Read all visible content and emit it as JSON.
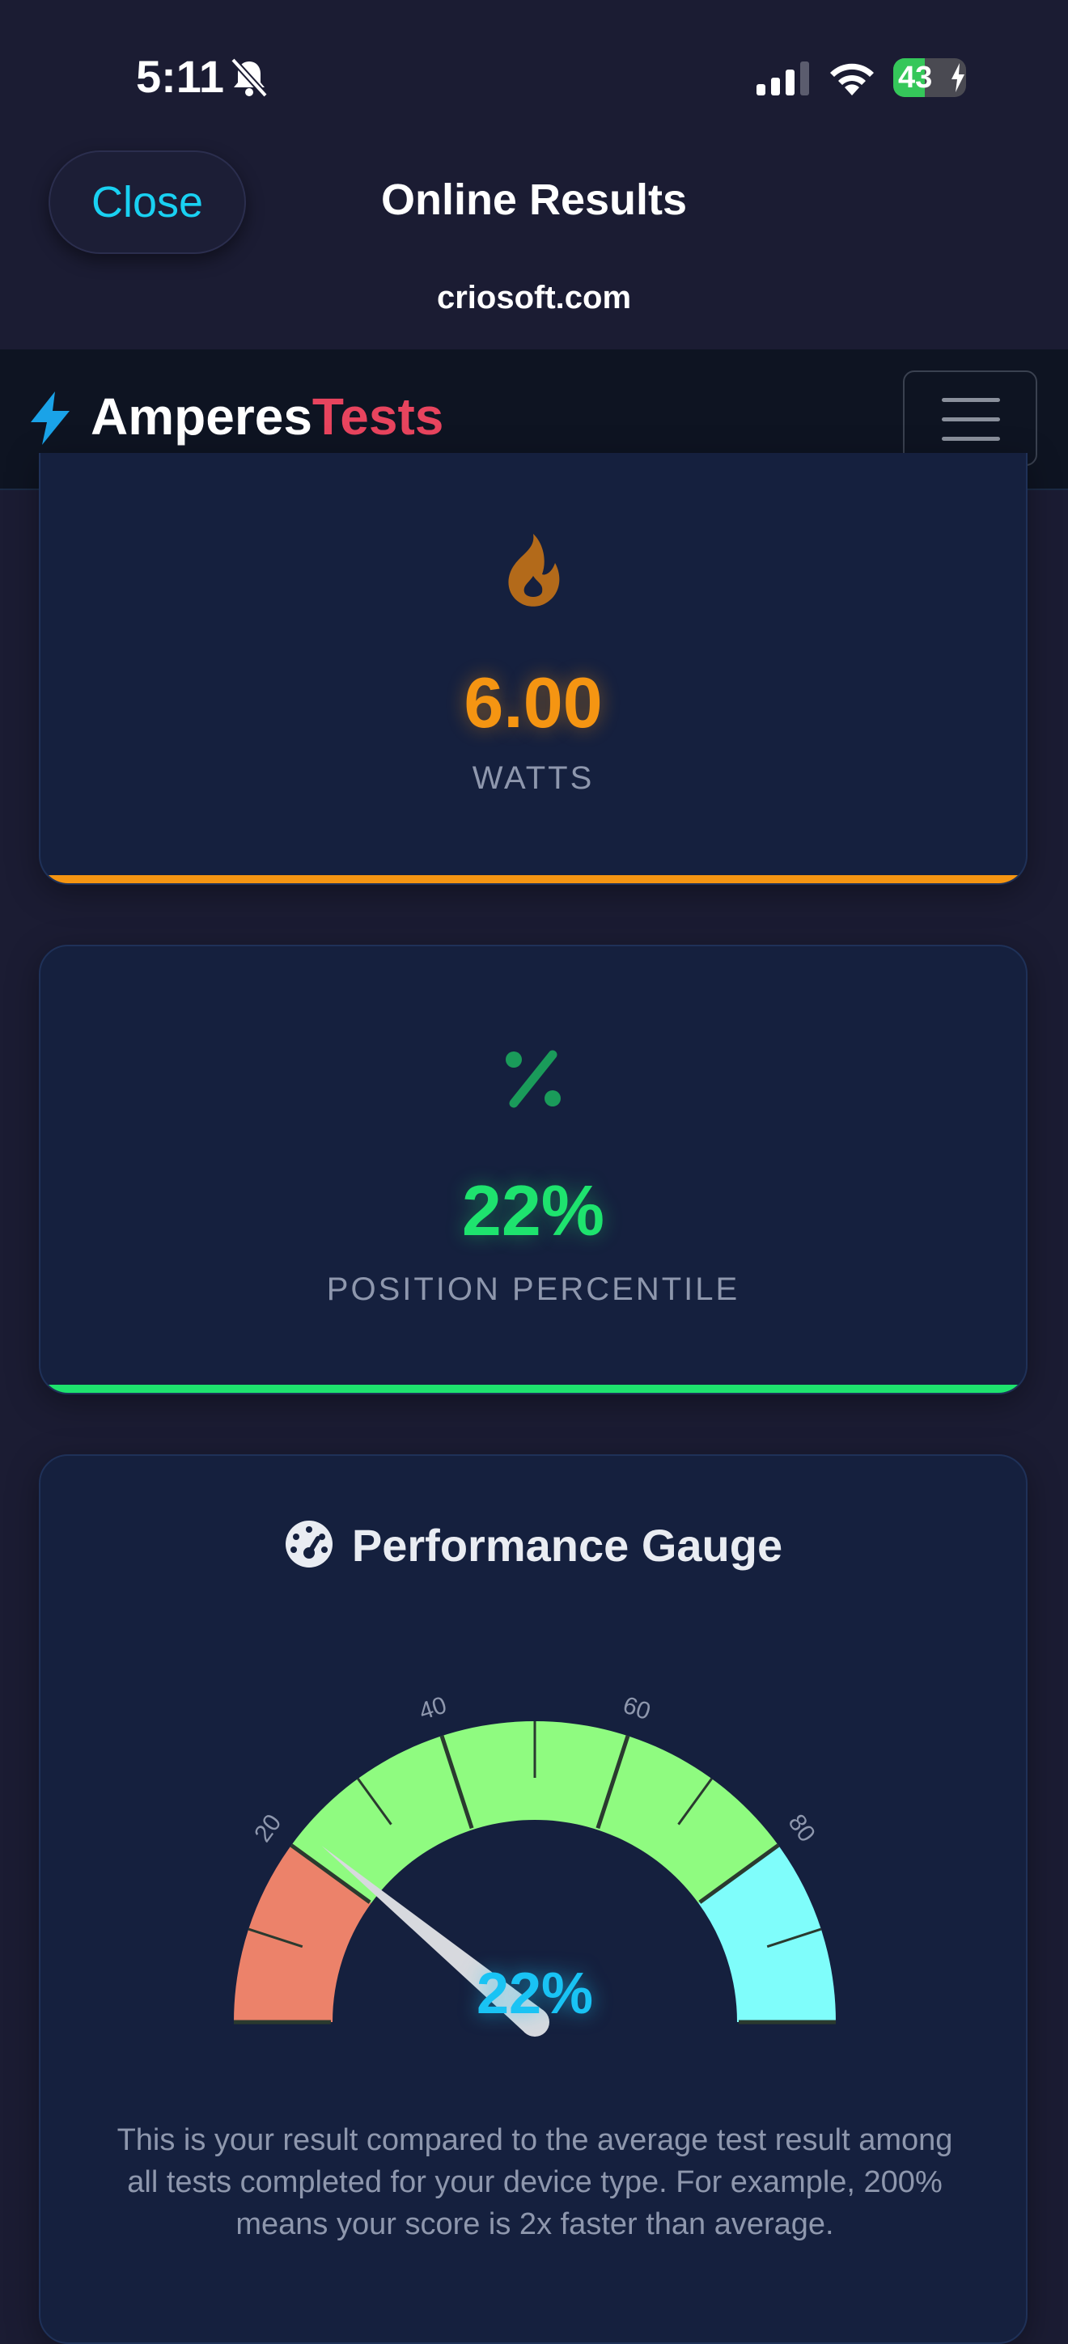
{
  "status_bar": {
    "time": "5:11",
    "battery_level": "43",
    "battery_percent": 43
  },
  "sheet": {
    "close_label": "Close",
    "title": "Online Results",
    "domain": "criosoft.com"
  },
  "site": {
    "brand_part1": "Amperes",
    "brand_part2": "Tests"
  },
  "cards": {
    "watts": {
      "value": "6.00",
      "label": "WATTS",
      "accent": "#f59512"
    },
    "percentile": {
      "value": "22%",
      "label": "POSITION PERCENTILE",
      "accent": "#1ee36e"
    }
  },
  "gauge": {
    "title": "Performance Gauge",
    "value_text": "22%",
    "value": 22,
    "range": [
      0,
      100
    ],
    "tick_labels": [
      "20",
      "40",
      "60",
      "80"
    ],
    "bands": [
      {
        "from": 0,
        "to": 20,
        "color": "#ec826a"
      },
      {
        "from": 20,
        "to": 80,
        "color": "#8ffb80"
      },
      {
        "from": 80,
        "to": 100,
        "color": "#7ffdfb"
      }
    ],
    "description": "This is your result compared to the average test result among all tests completed for your device type. For example, 200% means your score is 2x faster than average."
  },
  "icons": {
    "bell": "bell-slash-icon",
    "signal": "signal-icon",
    "wifi": "wifi-icon",
    "bolt": "bolt-icon",
    "menu": "hamburger-menu-icon",
    "fire": "fire-icon",
    "percent": "percent-icon",
    "gauge": "gauge-icon"
  }
}
